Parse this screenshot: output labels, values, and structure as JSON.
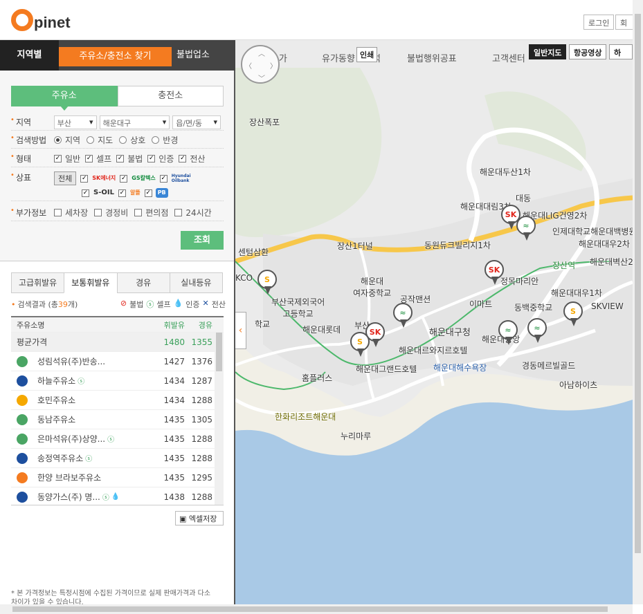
{
  "header": {
    "logo_o": "O",
    "logo_text": "pinet",
    "login": "로그인",
    "join": "회원"
  },
  "nav": {
    "region": "지역별",
    "find_station": "주유소/충전소 찾기",
    "illegal": "불법업소"
  },
  "map_links": {
    "domestic_price": "국내유가",
    "trend": "유가동향",
    "trend_tail": "분석",
    "illegal_notice": "불법행위공표",
    "customer_center": "고객센터",
    "print": "인쇄"
  },
  "map_buttons": {
    "normal": "일반지도",
    "aerial": "항공영상",
    "hybrid": "하이"
  },
  "filters": {
    "tab_gas": "주유소",
    "tab_charge": "충전소",
    "region_label": "지역",
    "city": "부산",
    "district": "해운대구",
    "dong": "읍/면/동",
    "method_label": "검색방법",
    "methods": [
      "지역",
      "지도",
      "상호",
      "반경"
    ],
    "type_label": "형태",
    "types": [
      "일반",
      "셀프",
      "불법",
      "인증",
      "전산"
    ],
    "brand_label": "상표",
    "brand_all": "전체",
    "brands": [
      {
        "name": "SK에너지",
        "color": "#e1251b"
      },
      {
        "name": "GS칼텍스",
        "color": "#0f8a3c"
      },
      {
        "name": "Hyundai Oilbank",
        "color": "#1d4f9e"
      },
      {
        "name": "S-OIL",
        "color": "#f5a800"
      },
      {
        "name": "알뜰",
        "color": "#f47b20"
      },
      {
        "name": "PB",
        "color": "#3a86d6"
      }
    ],
    "extra_label": "부가정보",
    "extras": [
      "세차장",
      "경정비",
      "편의점",
      "24시간"
    ],
    "search_button": "조회"
  },
  "fuel_tabs": [
    "고급휘발유",
    "보통휘발유",
    "경유",
    "실내등유"
  ],
  "result": {
    "prefix": "검색결과 (총 ",
    "count": "39",
    "suffix": "개)",
    "legend_illegal": "불법",
    "legend_self": "셀프",
    "legend_cert": "인증",
    "legend_online": "전산"
  },
  "table": {
    "col_name": "주유소명",
    "col_gas": "휘발유",
    "col_diesel": "경유",
    "avg_label": "평균가격",
    "avg_gas": "1480",
    "avg_diesel": "1355",
    "rows": [
      {
        "name": "성림석유(주)반송...",
        "gas": "1427",
        "diesel": "1376",
        "brand": "#4aa564",
        "self": false,
        "cert": false
      },
      {
        "name": "하늘주유소",
        "gas": "1434",
        "diesel": "1287",
        "brand": "#1d4f9e",
        "self": true,
        "cert": false
      },
      {
        "name": "호민주유소",
        "gas": "1434",
        "diesel": "1288",
        "brand": "#f5a800",
        "self": false,
        "cert": false
      },
      {
        "name": "동남주유소",
        "gas": "1435",
        "diesel": "1305",
        "brand": "#4aa564",
        "self": false,
        "cert": false
      },
      {
        "name": "은마석유(주)상양...",
        "gas": "1435",
        "diesel": "1288",
        "brand": "#4aa564",
        "self": true,
        "cert": false
      },
      {
        "name": "송정역주유소",
        "gas": "1435",
        "diesel": "1288",
        "brand": "#1d4f9e",
        "self": true,
        "cert": false
      },
      {
        "name": "한양 브라보주유소",
        "gas": "1435",
        "diesel": "1295",
        "brand": "#f47b20",
        "self": false,
        "cert": false
      },
      {
        "name": "동양가스(주) 명...",
        "gas": "1438",
        "diesel": "1288",
        "brand": "#1d4f9e",
        "self": true,
        "cert": true
      }
    ]
  },
  "excel_button": "엑셀저장",
  "note": "* 본 가격정보는 특정시점에 수집된 가격이므로 실제 판매가격과 다소 차이가 있을 수 있습니다.",
  "map_labels": {
    "jangsan_falls": "장산폭포",
    "dusan": "해운대두산1차",
    "daerim": "해운대대림3차",
    "daedong": "대동",
    "lig": "해운대LIG건영2차",
    "inje": "인제대학교해운대백병원",
    "daewoo2": "해운대대우2차",
    "jangsan_1": "장산1터널",
    "dongwon": "동원듀크빌리지1차",
    "jangsan_stn": "장산역",
    "bexco": "KCO",
    "center": "센텀삼환",
    "byeoksan": "해운대벽산2",
    "girls_high": "해운대\n여자중학교",
    "jeongmok": "정목마리안",
    "daewoo1": "해운대대우1차",
    "intl_high": "부산국제외국어\n고등학교",
    "gongjak": "공작맨션",
    "emart": "이마트",
    "dongbaek": "동백중학교",
    "skview": "SKVIEW",
    "hschool": "학교",
    "lotte": "해운대롯데",
    "busan": "부산",
    "gucheong": "해운대구청",
    "haeundae_jung": "해운대중앙",
    "haeundae_park": "해운대르와지르호텔",
    "grand": "해운대그랜드호텔",
    "beach": "해운대해수욕장",
    "metro": "경동메르빌골드",
    "homeplus": "홈플러스",
    "arpine": "아남하이츠",
    "hanwha": "한화리조트해운대",
    "nurimaru": "누리마루"
  }
}
